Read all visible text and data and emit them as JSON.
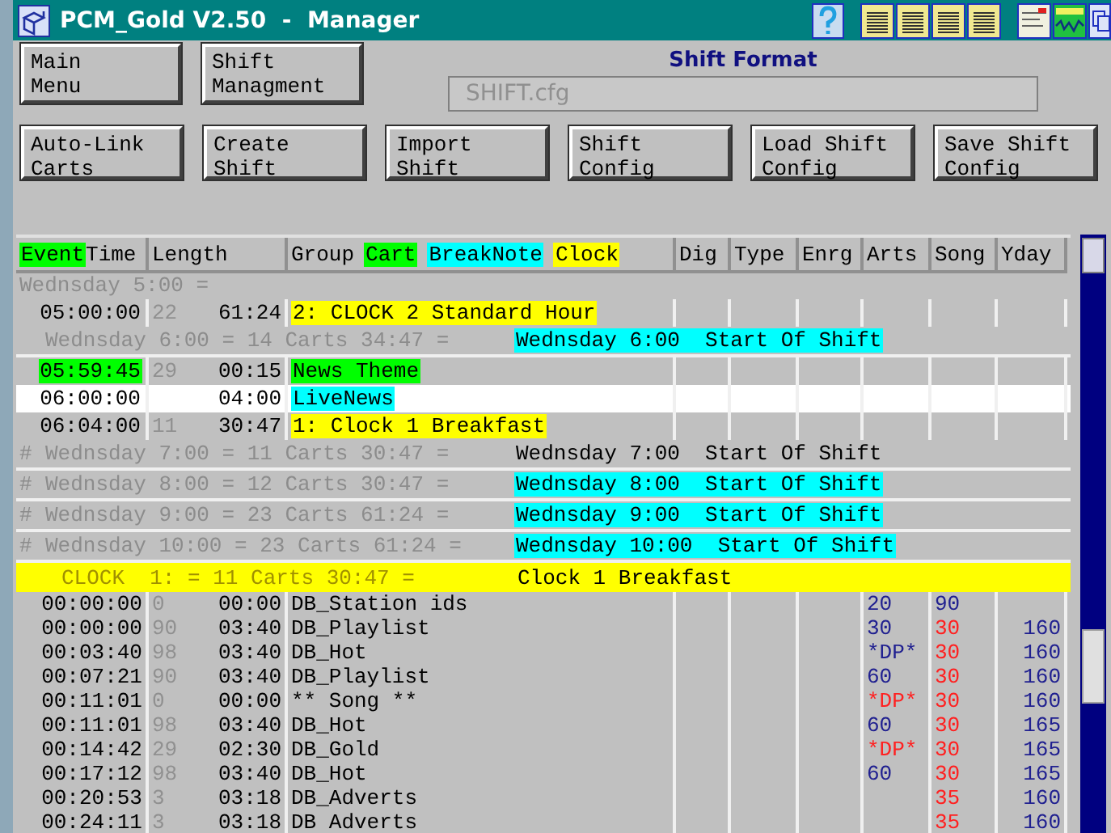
{
  "window": {
    "title": "PCM_Gold V2.50  -  Manager"
  },
  "top_buttons": [
    "Main\nMenu",
    "Shift\nManagment"
  ],
  "format": {
    "label": "Shift Format",
    "value": "SHIFT.cfg"
  },
  "action_buttons": [
    "Auto-Link\nCarts",
    "Create\nShift",
    "Import\nShift",
    "Shift\nConfig",
    "Load Shift\nConfig",
    "Save Shift\nConfig"
  ],
  "columns": [
    {
      "parts": [
        {
          "text": "Event",
          "color": "#00ff00"
        },
        {
          "text": "Time"
        }
      ]
    },
    {
      "parts": [
        {
          "text": "Length"
        }
      ]
    },
    {
      "parts": [
        {
          "text": "Group"
        },
        {
          "text": "Cart",
          "color": "#00ff00"
        },
        {
          "text": "BreakNote",
          "color": "#00ffff"
        },
        {
          "text": "Clock",
          "color": "#ffff00"
        }
      ]
    },
    {
      "parts": [
        {
          "text": "Dig"
        }
      ]
    },
    {
      "parts": [
        {
          "text": "Type"
        }
      ]
    },
    {
      "parts": [
        {
          "text": "Enrg"
        }
      ]
    },
    {
      "parts": [
        {
          "text": "Arts"
        }
      ]
    },
    {
      "parts": [
        {
          "text": "Song"
        }
      ]
    },
    {
      "parts": [
        {
          "text": "Yday"
        }
      ]
    }
  ],
  "rows": [
    {
      "kind": "day",
      "text": "Wednsday 5:00 ="
    },
    {
      "kind": "event",
      "selected": false,
      "time": {
        "text": "05:00:00"
      },
      "num": "22",
      "length": "61:24",
      "group": {
        "text": "2: CLOCK 2 Standard Hour",
        "color": "#ffff00"
      }
    },
    {
      "kind": "shift",
      "text": "Wednsday 6:00 = 14 Carts 34:47 =",
      "label": "Wednsday 6:00  Start Of Shift",
      "color": "#00ffff"
    },
    {
      "kind": "event",
      "selected": false,
      "time": {
        "text": "05:59:45",
        "color": "#00ff00"
      },
      "num": "29",
      "length": "00:15",
      "group": {
        "text": "News Theme",
        "color": "#00ff00"
      }
    },
    {
      "kind": "event",
      "selected": true,
      "time": {
        "text": "06:00:00"
      },
      "length": "04:00",
      "group": {
        "text": "LiveNews",
        "color": "#00ffff"
      }
    },
    {
      "kind": "event",
      "selected": false,
      "time": {
        "text": "06:04:00"
      },
      "num": "11",
      "length": "30:47",
      "group": {
        "text": "1: Clock 1 Breakfast",
        "color": "#ffff00"
      }
    },
    {
      "kind": "shift",
      "prefix": "#",
      "text": "Wednsday 7:00 = 11 Carts 30:47 =",
      "label": "Wednsday 7:00  Start Of Shift"
    },
    {
      "kind": "shift",
      "prefix": "#",
      "text": "Wednsday 8:00 = 12 Carts 30:47 =",
      "label": "Wednsday 8:00  Start Of Shift",
      "color": "#00ffff"
    },
    {
      "kind": "shift",
      "prefix": "#",
      "text": "Wednsday 9:00 = 23 Carts 61:24 =",
      "label": "Wednsday 9:00  Start Of Shift",
      "color": "#00ffff"
    },
    {
      "kind": "shift",
      "prefix": "#",
      "text": "Wednsday 10:00 = 23 Carts 61:24 =",
      "label": "Wednsday 10:00  Start Of Shift",
      "color": "#00ffff"
    },
    {
      "kind": "clock",
      "text": "CLOCK  1: = 11 Carts 30:47 =",
      "label": "Clock 1 Breakfast"
    },
    {
      "kind": "item",
      "time": "00:00:00",
      "num": "0",
      "length": "00:00",
      "group": "DB_Station ids",
      "arts": {
        "text": "20",
        "color": "#202090"
      },
      "song": {
        "text": "90",
        "color": "#202090"
      }
    },
    {
      "kind": "item",
      "time": "00:00:00",
      "num": "90",
      "length": "03:40",
      "group": "DB_Playlist",
      "arts": {
        "text": "30",
        "color": "#202090"
      },
      "song": {
        "text": "30",
        "color": "#ff2020"
      },
      "yday": "160"
    },
    {
      "kind": "item",
      "time": "00:03:40",
      "num": "98",
      "length": "03:40",
      "group": "DB_Hot",
      "arts": {
        "text": "*DP*",
        "color": "#202090"
      },
      "song": {
        "text": "30",
        "color": "#ff2020"
      },
      "yday": "160"
    },
    {
      "kind": "item",
      "time": "00:07:21",
      "num": "90",
      "length": "03:40",
      "group": "DB_Playlist",
      "arts": {
        "text": "60",
        "color": "#202090"
      },
      "song": {
        "text": "30",
        "color": "#ff2020"
      },
      "yday": "160"
    },
    {
      "kind": "item",
      "time": "00:11:01",
      "num": "0",
      "length": "00:00",
      "group": "** Song **",
      "arts": {
        "text": "*DP*",
        "color": "#ff2020"
      },
      "song": {
        "text": "30",
        "color": "#ff2020"
      },
      "yday": "160"
    },
    {
      "kind": "item",
      "time": "00:11:01",
      "num": "98",
      "length": "03:40",
      "group": "DB_Hot",
      "arts": {
        "text": "60",
        "color": "#202090"
      },
      "song": {
        "text": "30",
        "color": "#ff2020"
      },
      "yday": "165"
    },
    {
      "kind": "item",
      "time": "00:14:42",
      "num": "29",
      "length": "02:30",
      "group": "DB_Gold",
      "arts": {
        "text": "*DP*",
        "color": "#ff2020"
      },
      "song": {
        "text": "30",
        "color": "#ff2020"
      },
      "yday": "165"
    },
    {
      "kind": "item",
      "time": "00:17:12",
      "num": "98",
      "length": "03:40",
      "group": "DB_Hot",
      "arts": {
        "text": "60",
        "color": "#202090"
      },
      "song": {
        "text": "30",
        "color": "#ff2020"
      },
      "yday": "165"
    },
    {
      "kind": "item",
      "time": "00:20:53",
      "num": "3",
      "length": "03:18",
      "group": "DB_Adverts",
      "song": {
        "text": "35",
        "color": "#ff2020"
      },
      "yday": "160"
    },
    {
      "kind": "item",
      "time": "00:24:11",
      "num": "3",
      "length": "03:18",
      "group": "DB Adverts",
      "song": {
        "text": "35",
        "color": "#ff2020"
      },
      "yday": "160"
    }
  ]
}
